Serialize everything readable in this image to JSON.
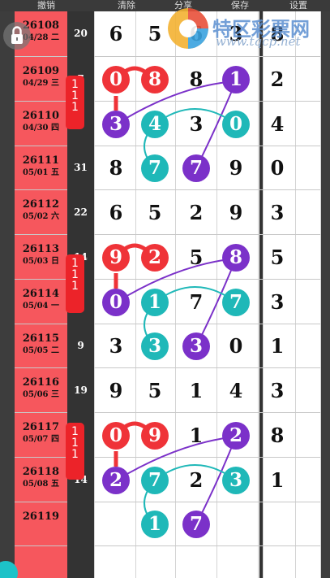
{
  "toolbar": {
    "undo": "撤销",
    "clear": "清除",
    "share": "分享",
    "save": "保存",
    "settings": "设置"
  },
  "watermark": {
    "site_name": "特区彩票网",
    "url": "www.tqcp.net"
  },
  "rows": [
    {
      "issue": "26108",
      "date": "04/28 二",
      "count": "20",
      "digits": [
        "6",
        "5",
        "6",
        "3"
      ],
      "extra": "8"
    },
    {
      "issue": "26109",
      "date": "04/29 三",
      "count": "7",
      "digits": [
        "0",
        "8",
        "8",
        "1"
      ],
      "extra": "2"
    },
    {
      "issue": "26110",
      "date": "04/30 四",
      "count": "0",
      "digits": [
        "3",
        "4",
        "3",
        "0"
      ],
      "extra": "4"
    },
    {
      "issue": "26111",
      "date": "05/01 五",
      "count": "31",
      "digits": [
        "8",
        "7",
        "7",
        "9"
      ],
      "extra": "0"
    },
    {
      "issue": "26112",
      "date": "05/02 六",
      "count": "22",
      "digits": [
        "6",
        "5",
        "2",
        "9"
      ],
      "extra": "3"
    },
    {
      "issue": "26113",
      "date": "05/03 日",
      "count": "14",
      "digits": [
        "9",
        "2",
        "5",
        "8"
      ],
      "extra": "5"
    },
    {
      "issue": "26114",
      "date": "05/04 一",
      "count": "",
      "digits": [
        "0",
        "1",
        "7",
        "7"
      ],
      "extra": "3"
    },
    {
      "issue": "26115",
      "date": "05/05 二",
      "count": "9",
      "digits": [
        "3",
        "3",
        "3",
        "0"
      ],
      "extra": "1"
    },
    {
      "issue": "26116",
      "date": "05/06 三",
      "count": "19",
      "digits": [
        "9",
        "5",
        "1",
        "4"
      ],
      "extra": "3"
    },
    {
      "issue": "26117",
      "date": "05/07 四",
      "count": "",
      "digits": [
        "0",
        "9",
        "1",
        "2"
      ],
      "extra": "8"
    },
    {
      "issue": "26118",
      "date": "05/08 五",
      "count": "14",
      "digits": [
        "2",
        "7",
        "2",
        "3"
      ],
      "extra": "1"
    },
    {
      "issue": "26119",
      "date": "",
      "count": "",
      "digits": [
        "",
        "1",
        "7",
        ""
      ],
      "extra": ""
    }
  ],
  "tags": [
    {
      "text": "1 1 1"
    },
    {
      "text": "1 1 1"
    },
    {
      "text": "1 1 1"
    }
  ],
  "colors": {
    "red": "#ef3338",
    "purple": "#7b31c9",
    "teal": "#1fb8b8",
    "issue_bg": "#f6575d"
  }
}
